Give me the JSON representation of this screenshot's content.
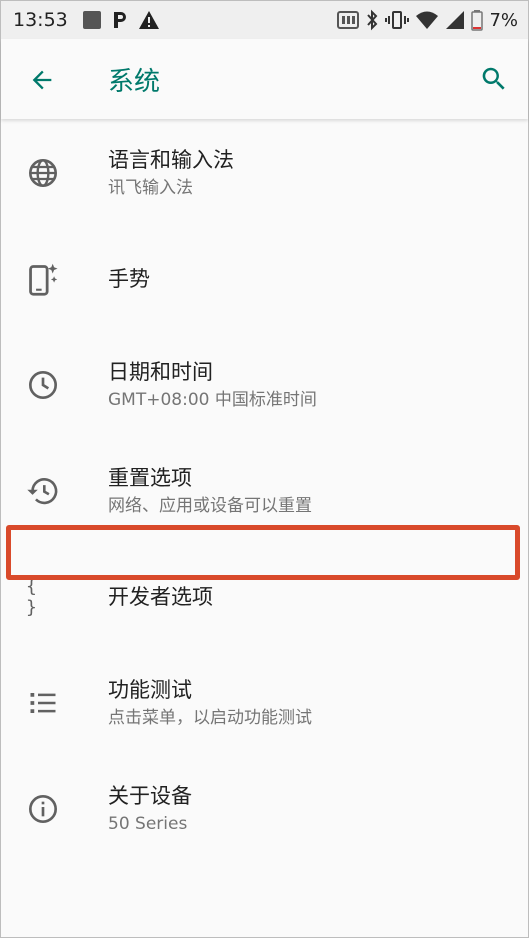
{
  "status": {
    "time": "13:53",
    "battery": "7%"
  },
  "appbar": {
    "title": "系统",
    "back_icon": "arrow-back-icon",
    "search_icon": "search-icon",
    "accent_color": "#00796b"
  },
  "items": [
    {
      "label": "语言和输入法",
      "sub": "讯飞输入法",
      "icon": "globe-icon"
    },
    {
      "label": "手势",
      "sub": "",
      "icon": "gesture-phone-icon"
    },
    {
      "label": "日期和时间",
      "sub": "GMT+08:00 中国标准时间",
      "icon": "clock-icon"
    },
    {
      "label": "重置选项",
      "sub": "网络、应用或设备可以重置",
      "icon": "restore-icon"
    },
    {
      "label": "开发者选项",
      "sub": "",
      "icon": "braces-icon",
      "icon_text": "{ }"
    },
    {
      "label": "功能测试",
      "sub": "点击菜单，以启动功能测试",
      "icon": "list-icon"
    },
    {
      "label": "关于设备",
      "sub": "50 Series",
      "icon": "info-icon"
    }
  ],
  "highlight_color": "#d94a2b"
}
